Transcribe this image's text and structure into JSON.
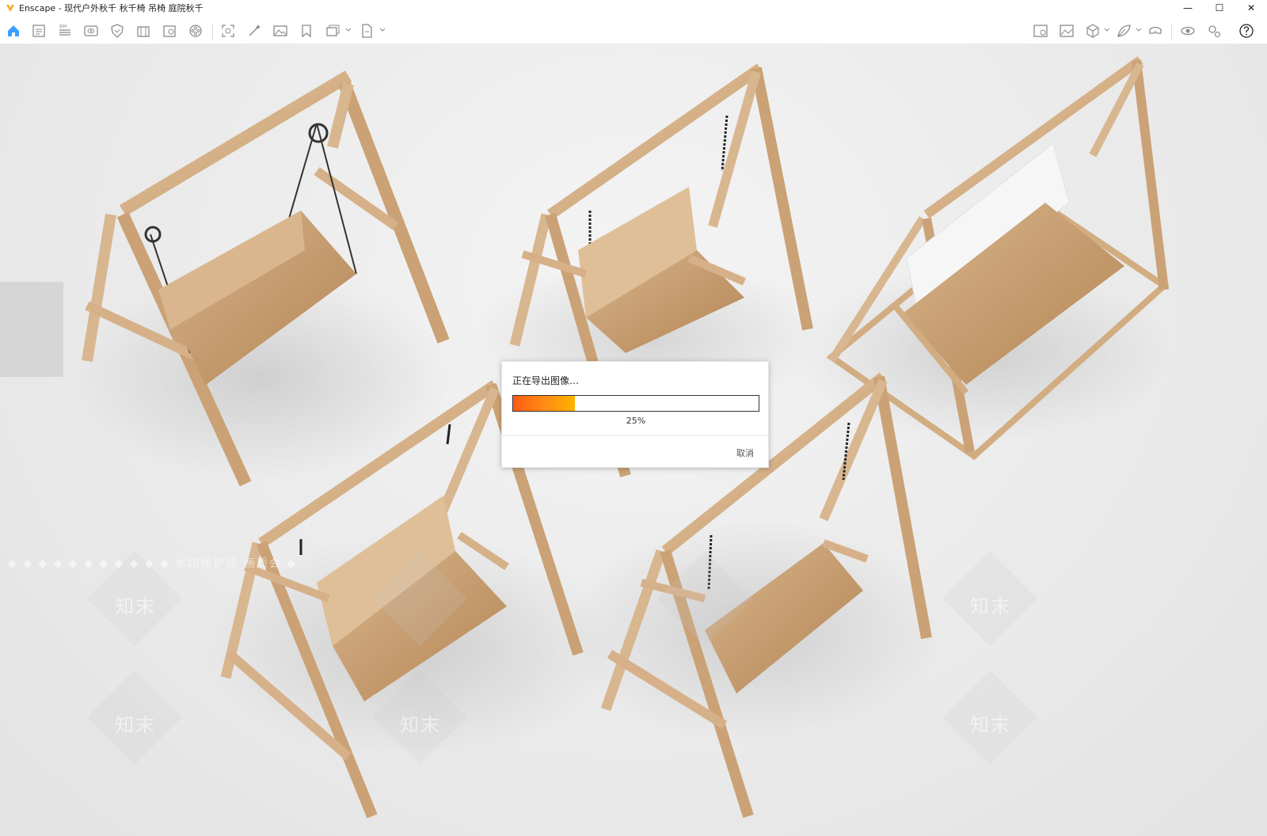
{
  "window": {
    "title": "Enscape - 现代户外秋千 秋千椅 吊椅 庭院秋千",
    "minimize_glyph": "—",
    "maximize_glyph": "☐",
    "close_glyph": "✕"
  },
  "toolbar": {
    "left_icons": [
      "home-icon",
      "document-icon",
      "bim-icon",
      "eye-icon",
      "shield-icon",
      "building-icon",
      "media-icon",
      "film-reel-icon",
      "screenshot-icon",
      "magic-wand-icon",
      "image-icon",
      "bookmark-icon",
      "batch-render-icon",
      "export-icon"
    ],
    "right_icons": [
      "map-icon",
      "gallery-icon",
      "cube-icon",
      "asset-leaf-icon",
      "vr-headset-icon",
      "visual-settings-icon",
      "settings-icon",
      "help-icon"
    ],
    "accent": "#3aa0ff"
  },
  "dialog": {
    "title": "正在导出图像…",
    "progress": 0.25,
    "progress_label": "25%",
    "cancel_label": "取消"
  },
  "watermark": {
    "band_text": "◆ ◆ ◆ ◆ ◆ ◆ ◆ ◆ ◆ ◆ ◆   水印保护区   画质会   ◆",
    "brand": "知末"
  }
}
